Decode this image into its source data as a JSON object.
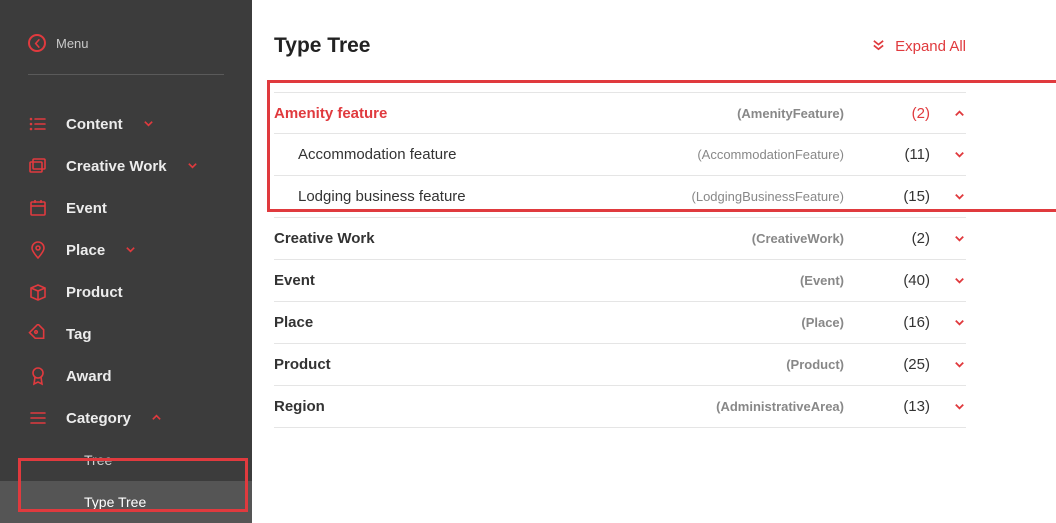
{
  "sidebar": {
    "menu_label": "Menu",
    "items": [
      {
        "label": "Content",
        "has_sub": true
      },
      {
        "label": "Creative Work",
        "has_sub": true
      },
      {
        "label": "Event",
        "has_sub": false
      },
      {
        "label": "Place",
        "has_sub": true
      },
      {
        "label": "Product",
        "has_sub": false
      },
      {
        "label": "Tag",
        "has_sub": false
      },
      {
        "label": "Award",
        "has_sub": false
      },
      {
        "label": "Category",
        "has_sub": true,
        "expanded": true
      }
    ],
    "category_subs": {
      "tree": "Tree",
      "type_tree": "Type Tree"
    }
  },
  "main": {
    "title": "Type Tree",
    "expand_all": "Expand All",
    "rows": {
      "amenity": {
        "name": "Amenity feature",
        "type": "(AmenityFeature)",
        "count": "(2)"
      },
      "accommodation": {
        "name": "Accommodation feature",
        "type": "(AccommodationFeature)",
        "count": "(11)"
      },
      "lodging": {
        "name": "Lodging business feature",
        "type": "(LodgingBusinessFeature)",
        "count": "(15)"
      },
      "creative": {
        "name": "Creative Work",
        "type": "(CreativeWork)",
        "count": "(2)"
      },
      "event": {
        "name": "Event",
        "type": "(Event)",
        "count": "(40)"
      },
      "place": {
        "name": "Place",
        "type": "(Place)",
        "count": "(16)"
      },
      "product": {
        "name": "Product",
        "type": "(Product)",
        "count": "(25)"
      },
      "region": {
        "name": "Region",
        "type": "(AdministrativeArea)",
        "count": "(13)"
      }
    }
  }
}
